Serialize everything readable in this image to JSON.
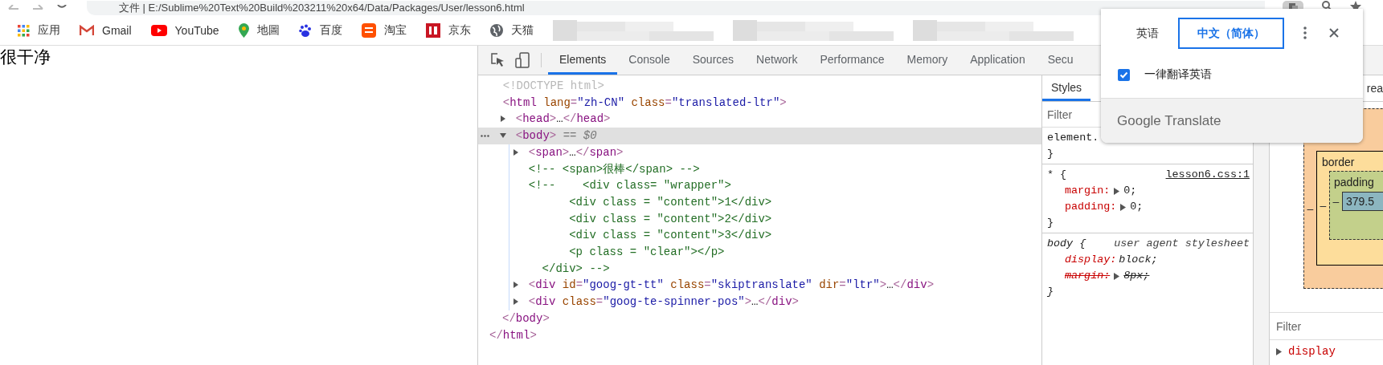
{
  "address_bar": {
    "url": "文件 | E:/Sublime%20Text%20Build%203211%20x64/Data/Packages/User/lesson6.html"
  },
  "bookmarks": [
    {
      "kind": "apps",
      "label": "应用"
    },
    {
      "kind": "gmail",
      "label": "Gmail"
    },
    {
      "kind": "youtube",
      "label": "YouTube"
    },
    {
      "kind": "maps",
      "label": "地圖"
    },
    {
      "kind": "baidu",
      "label": "百度"
    },
    {
      "kind": "taobao",
      "label": "淘宝"
    },
    {
      "kind": "jd",
      "label": "京东"
    },
    {
      "kind": "globe",
      "label": "天猫"
    },
    {
      "kind": "blurred"
    },
    {
      "kind": "blurred"
    },
    {
      "kind": "blurred"
    }
  ],
  "page": {
    "text": "很干净"
  },
  "devtools": {
    "tabs": [
      {
        "label": "Elements",
        "selected": true
      },
      {
        "label": "Console",
        "selected": false
      },
      {
        "label": "Sources",
        "selected": false
      },
      {
        "label": "Network",
        "selected": false
      },
      {
        "label": "Performance",
        "selected": false
      },
      {
        "label": "Memory",
        "selected": false
      },
      {
        "label": "Application",
        "selected": false
      },
      {
        "label": "Secu",
        "selected": false
      }
    ],
    "dom": [
      {
        "selected": false,
        "segments": [
          {
            "kind": "doctype",
            "text": "<!DOCTYPE html>"
          }
        ]
      },
      {
        "selected": false,
        "segments": [
          {
            "kind": "punct",
            "text": "<"
          },
          {
            "kind": "tag",
            "text": "html"
          },
          {
            "kind": "attr",
            "text": " lang"
          },
          {
            "kind": "punct",
            "text": "="
          },
          {
            "kind": "value",
            "text": "\"zh-CN\""
          },
          {
            "kind": "attr",
            "text": " class"
          },
          {
            "kind": "punct",
            "text": "="
          },
          {
            "kind": "value",
            "text": "\"translated-ltr\""
          },
          {
            "kind": "punct",
            "text": ">"
          }
        ],
        "children": [
          {
            "selected": false,
            "expanded": false,
            "segments": [
              {
                "kind": "punct",
                "text": "<"
              },
              {
                "kind": "tag",
                "text": "head"
              },
              {
                "kind": "punct",
                "text": ">"
              },
              {
                "kind": "text",
                "text": "…"
              },
              {
                "kind": "punct",
                "text": "</"
              },
              {
                "kind": "tag",
                "text": "head"
              },
              {
                "kind": "punct",
                "text": ">"
              }
            ]
          },
          {
            "selected": true,
            "expanded": true,
            "segments": [
              {
                "kind": "punct",
                "text": "<"
              },
              {
                "kind": "tag",
                "text": "body"
              },
              {
                "kind": "punct",
                "text": ">"
              },
              {
                "kind": "hint",
                "text": " == $0"
              }
            ],
            "children": [
              {
                "selected": false,
                "expanded": false,
                "segments": [
                  {
                    "kind": "punct",
                    "text": "<"
                  },
                  {
                    "kind": "tag",
                    "text": "span"
                  },
                  {
                    "kind": "punct",
                    "text": ">"
                  },
                  {
                    "kind": "text",
                    "text": "…"
                  },
                  {
                    "kind": "punct",
                    "text": "</"
                  },
                  {
                    "kind": "tag",
                    "text": "span"
                  },
                  {
                    "kind": "punct",
                    "text": ">"
                  }
                ]
              },
              {
                "selected": false,
                "segments": [
                  {
                    "kind": "comment",
                    "text": "<!-- <span>很棒</span> -->"
                  }
                ]
              },
              {
                "selected": false,
                "segments": [
                  {
                    "kind": "comment",
                    "text": "<!--    <div class= \"wrapper\">\n        <div class = \"content\">1</div>\n        <div class = \"content\">2</div>\n        <div class = \"content\">3</div>\n        <p class = \"clear\"></p>\n    </div> -->"
                  }
                ]
              },
              {
                "selected": false,
                "expanded": false,
                "segments": [
                  {
                    "kind": "punct",
                    "text": "<"
                  },
                  {
                    "kind": "tag",
                    "text": "div"
                  },
                  {
                    "kind": "attr",
                    "text": " id"
                  },
                  {
                    "kind": "punct",
                    "text": "="
                  },
                  {
                    "kind": "value",
                    "text": "\"goog-gt-tt\""
                  },
                  {
                    "kind": "attr",
                    "text": " class"
                  },
                  {
                    "kind": "punct",
                    "text": "="
                  },
                  {
                    "kind": "value",
                    "text": "\"skiptranslate\""
                  },
                  {
                    "kind": "attr",
                    "text": " dir"
                  },
                  {
                    "kind": "punct",
                    "text": "="
                  },
                  {
                    "kind": "value",
                    "text": "\"ltr\""
                  },
                  {
                    "kind": "punct",
                    "text": ">"
                  },
                  {
                    "kind": "text",
                    "text": "…"
                  },
                  {
                    "kind": "punct",
                    "text": "</"
                  },
                  {
                    "kind": "tag",
                    "text": "div"
                  },
                  {
                    "kind": "punct",
                    "text": ">"
                  }
                ]
              },
              {
                "selected": false,
                "expanded": false,
                "segments": [
                  {
                    "kind": "punct",
                    "text": "<"
                  },
                  {
                    "kind": "tag",
                    "text": "div"
                  },
                  {
                    "kind": "attr",
                    "text": " class"
                  },
                  {
                    "kind": "punct",
                    "text": "="
                  },
                  {
                    "kind": "value",
                    "text": "\"goog-te-spinner-pos\""
                  },
                  {
                    "kind": "punct",
                    "text": ">"
                  },
                  {
                    "kind": "text",
                    "text": "…"
                  },
                  {
                    "kind": "punct",
                    "text": "</"
                  },
                  {
                    "kind": "tag",
                    "text": "div"
                  },
                  {
                    "kind": "punct",
                    "text": ">"
                  }
                ]
              }
            ],
            "closing": [
              {
                "kind": "punct",
                "text": "</"
              },
              {
                "kind": "tag",
                "text": "body"
              },
              {
                "kind": "punct",
                "text": ">"
              }
            ]
          }
        ],
        "closing": [
          {
            "kind": "punct",
            "text": "</"
          },
          {
            "kind": "tag",
            "text": "html"
          },
          {
            "kind": "punct",
            "text": ">"
          }
        ]
      }
    ],
    "styles": {
      "tabs": [
        {
          "label": "Styles",
          "selected": true
        }
      ],
      "filter": {
        "placeholder": "Filter"
      },
      "rules": [
        {
          "kind": "element",
          "selector": "element.",
          "closing": "}"
        },
        {
          "kind": "author",
          "selector": "* {",
          "source": "lesson6.css:1",
          "closing": "}",
          "declarations": [
            {
              "name": "margin:",
              "value": "0;",
              "expandable": true,
              "overridden": false
            },
            {
              "name": "padding:",
              "value": "0;",
              "expandable": true,
              "overridden": false
            }
          ]
        },
        {
          "kind": "user_agent",
          "selector": "body {",
          "source": "user agent stylesheet",
          "closing": "}",
          "declarations": [
            {
              "name": "display:",
              "value": "block;",
              "expandable": false,
              "overridden": false
            },
            {
              "name": "margin:",
              "value": "8px;",
              "expandable": true,
              "overridden": true
            }
          ]
        }
      ]
    },
    "computed": {
      "tab_label": "rea",
      "box_model": {
        "border_label": "border",
        "padding_label": "padding",
        "margin_left": "–",
        "border_left": "–",
        "padding_left": "–",
        "content": "379.5"
      },
      "filter": {
        "placeholder": "Filter"
      },
      "properties": [
        {
          "name": "display"
        }
      ]
    }
  },
  "translate_popup": {
    "languages": [
      {
        "label": "英语",
        "selected": false
      },
      {
        "label": "中文（简体）",
        "selected": true
      }
    ],
    "option": {
      "label": "一律翻译英语",
      "checked": true
    },
    "footer": "Google Translate"
  }
}
